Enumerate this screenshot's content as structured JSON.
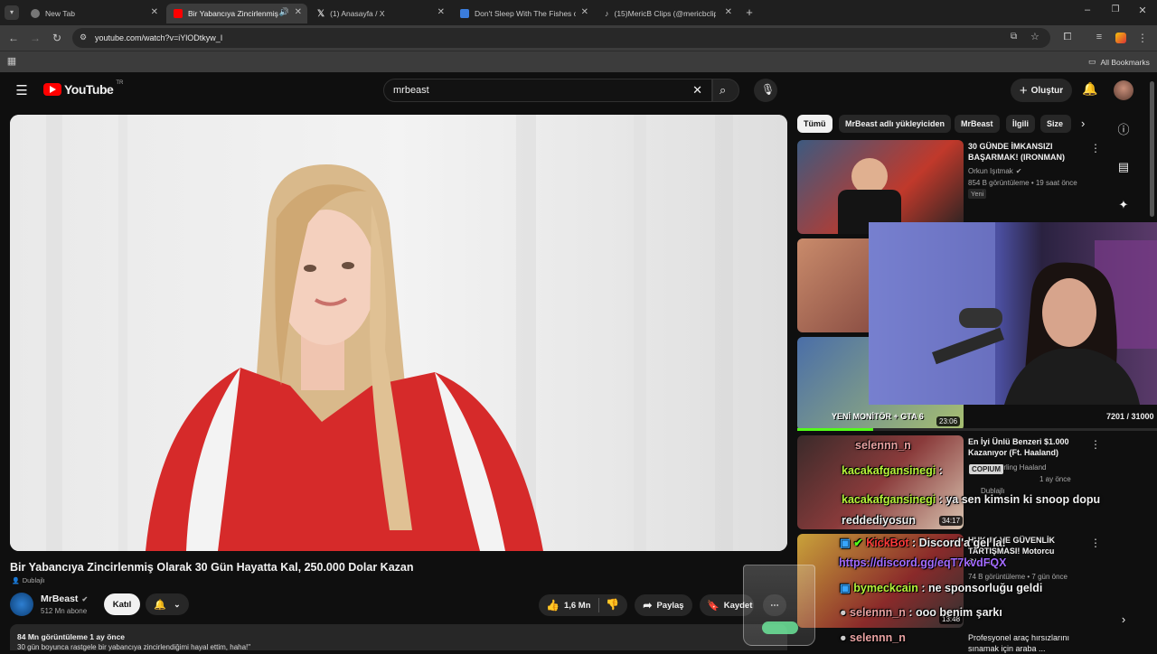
{
  "browser": {
    "tabs": [
      {
        "label": "New Tab",
        "active": false,
        "fav": "#888888"
      },
      {
        "label": "Bir Yabancıya Zincirlenmiş Ol",
        "active": true,
        "fav": "#ff0000"
      },
      {
        "label": "(1) Anasayfa / X",
        "active": false,
        "fav": "#ffffff"
      },
      {
        "label": "Don't Sleep With The Fishes on",
        "active": false,
        "fav": "#3b7ddd"
      },
      {
        "label": "(15)MericB Clips (@mericbclips",
        "active": false,
        "fav": "#111111"
      }
    ],
    "url": "youtube.com/watch?v=iYlODtkyw_I",
    "bookmarks_label": "All Bookmarks"
  },
  "youtube": {
    "logo_text": "YouTube",
    "region": "TR",
    "search_value": "mrbeast",
    "create_label": "Oluştur",
    "video": {
      "title": "Bir Yabancıya Zincirlenmiş Olarak 30 Gün Hayatta Kal, 250.000 Dolar Kazan",
      "dubbed": "Dublajlı",
      "channel": "MrBeast",
      "subscribers": "512 Mn abone",
      "join_label": "Katıl",
      "likes": "1,6 Mn",
      "share_label": "Paylaş",
      "save_label": "Kaydet",
      "views_date": "84 Mn görüntüleme  1 ay önce",
      "desc": "30 gün boyunca rastgele bir yabancıya zincirlendiğimi hayal ettim, haha!\""
    },
    "chips": [
      "Tümü",
      "MrBeast adlı yükleyiciden",
      "MrBeast",
      "İlgili",
      "Size"
    ],
    "related": [
      {
        "title": "30 GÜNDE İMKANSIZI BAŞARMAK! (IRONMAN)",
        "channel": "Orkun Işıtmak",
        "meta": "854 B görüntüleme • 19 saat önce",
        "badge": "Yeni"
      },
      {
        "title": "En İyi Ünlü Benzeri $1.000 Kazanıyor (Ft. Haaland)",
        "channel": "Erling Haaland",
        "meta": "1 ay önce",
        "badge": "Dublajlı",
        "duration": "34:17"
      },
      {
        "title": "HUKUK VE GÜVENLİK TARTIŞMASI! Motorcu Olayla...",
        "channel": "",
        "meta": "74 B görüntüleme • 7 gün önce",
        "duration": "13:48"
      },
      {
        "title": "Profesyonel araç hırsızlarını sınamak için araba ...",
        "channel": "",
        "meta": ""
      }
    ]
  },
  "stream": {
    "webcam_overlay": "YENİ MONİTÖR + GTA 6",
    "video_duration": "23:06",
    "counter": "7201 / 31000",
    "emote": "COPIUM",
    "chat": [
      {
        "user": "selennn_n",
        "text": "",
        "color": "#e8a2a2"
      },
      {
        "user": "kacakafgansinegi",
        "text": " :",
        "color": "#b7f53b"
      },
      {
        "user": "kacakafgansinegi",
        "text": " : ya sen kimsin ki snoop dopu reddediyosun",
        "color": "#b7f53b"
      },
      {
        "user": "KickBot",
        "text": " : Discord'a gel la!",
        "color": "#ff3a3a"
      },
      {
        "link": "https://discord.gg/eqT7kvdFQX"
      },
      {
        "user": "bymeckcain",
        "text": " : ne sponsorluğu geldi",
        "color": "#b7f53b"
      },
      {
        "user": "selennn_n",
        "text": " : ooo benim şarkı",
        "color": "#e8a2a2"
      },
      {
        "user": "selennn_n",
        "text": "",
        "color": "#e8a2a2"
      }
    ]
  }
}
